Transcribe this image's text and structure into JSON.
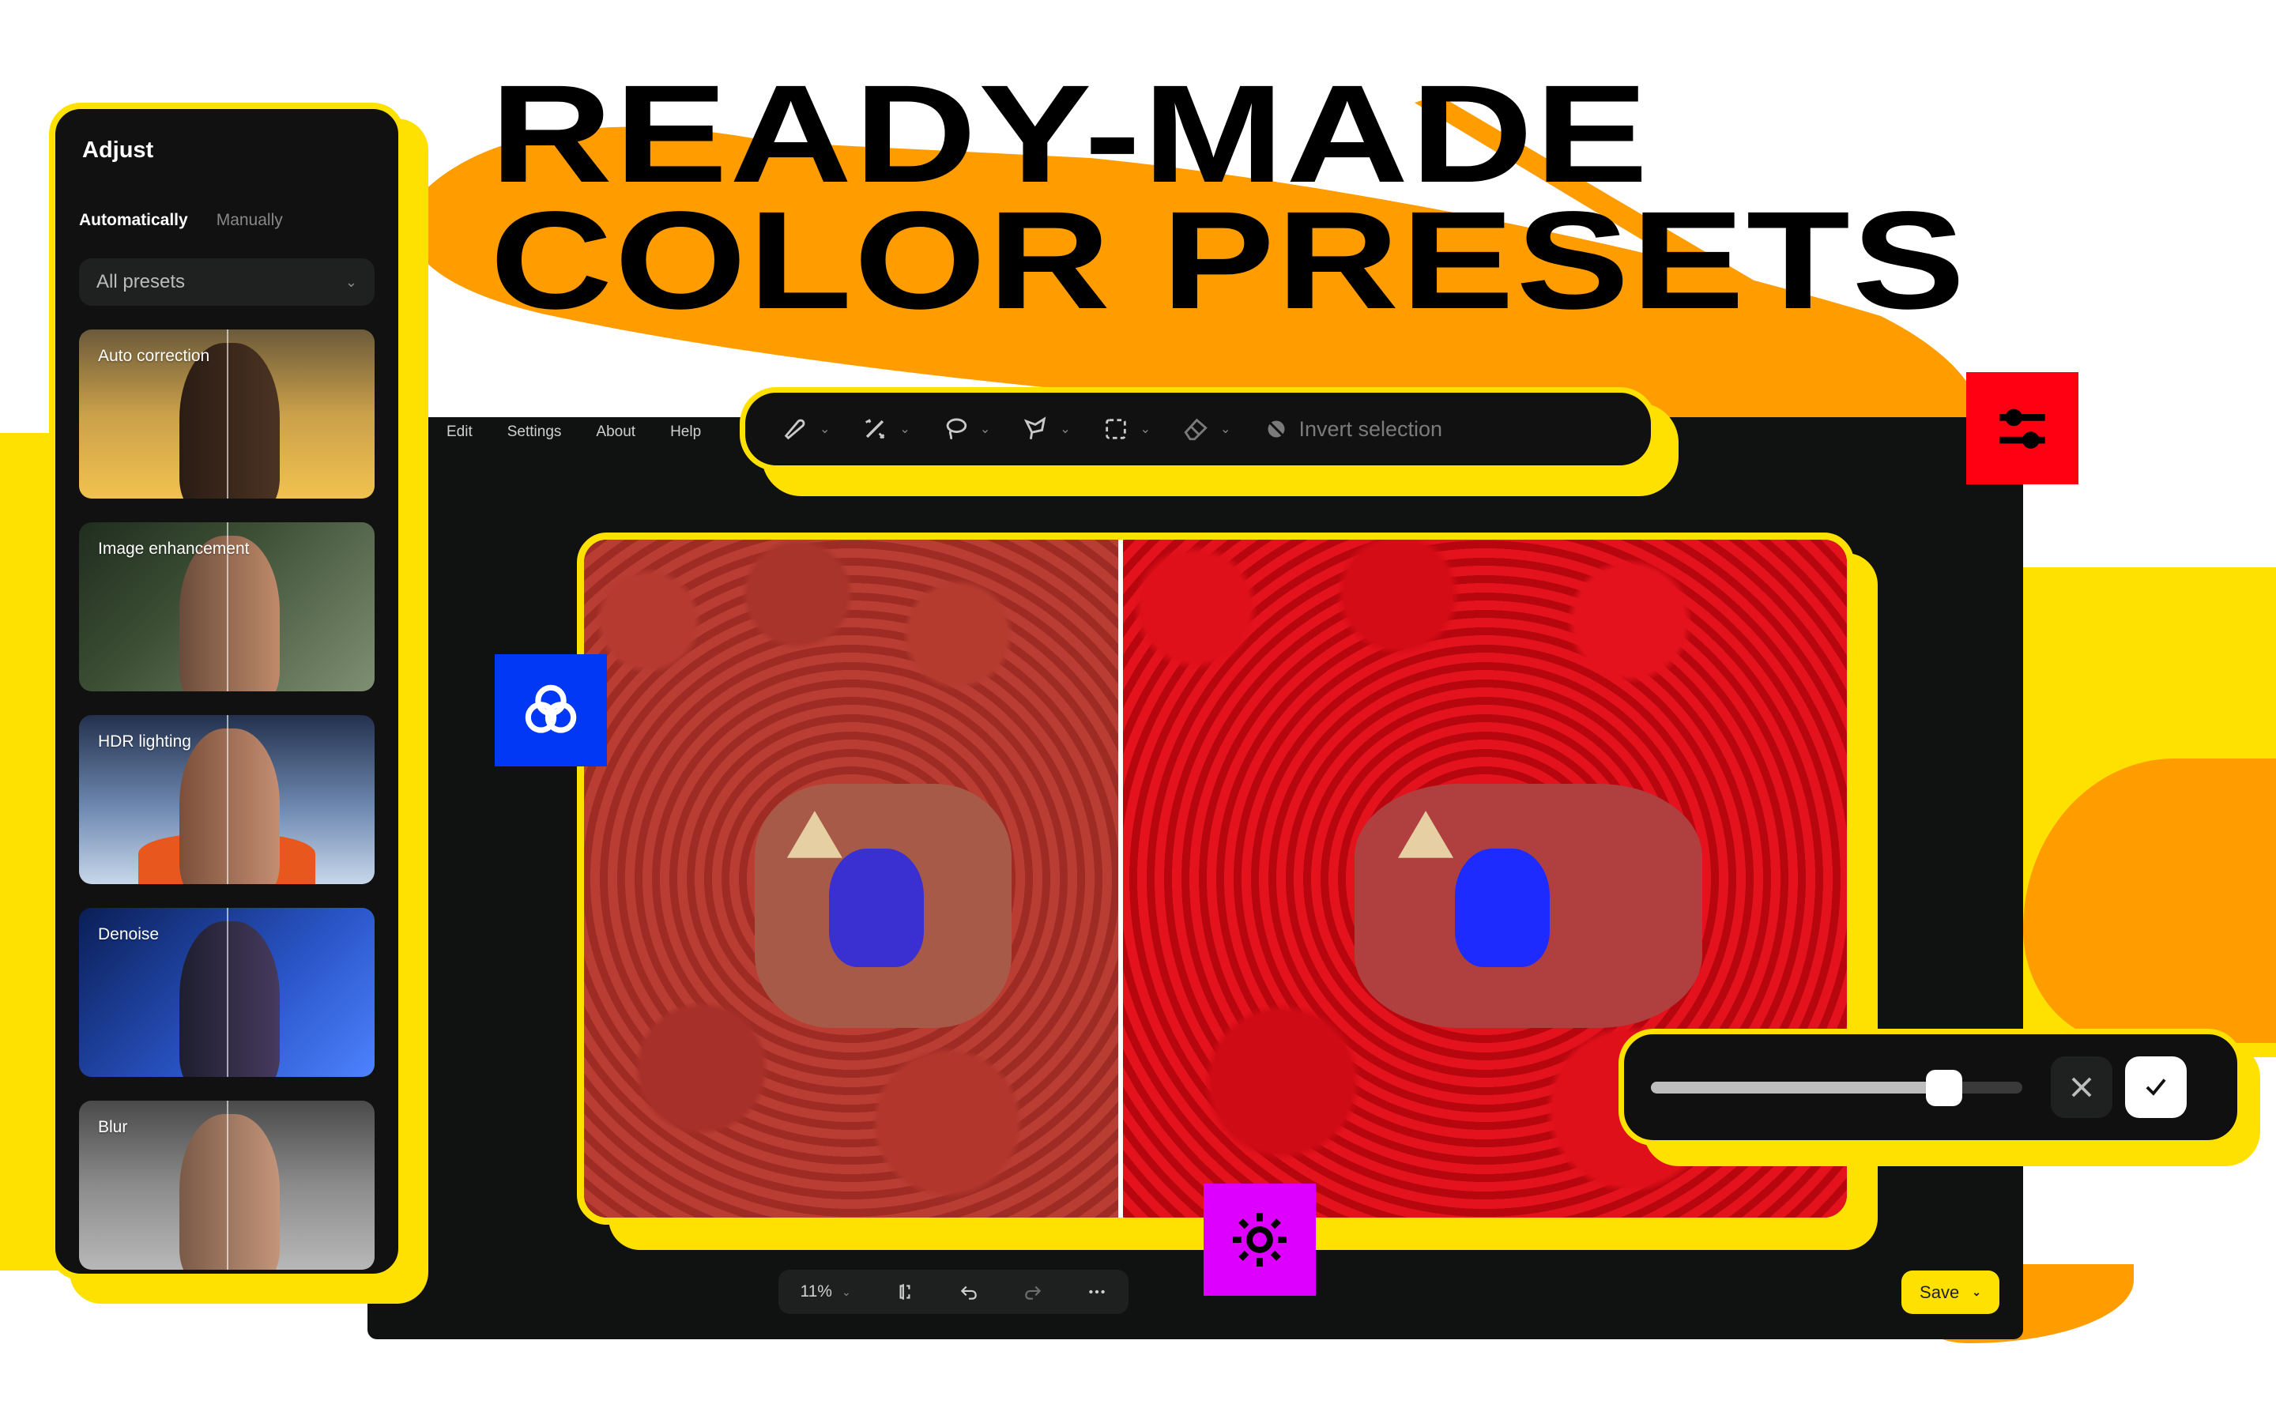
{
  "headline": {
    "line1": "READY-MADE",
    "line2": "COLOR PRESETS"
  },
  "colors": {
    "accent_yellow": "#FFE100",
    "accent_orange": "#FF9C00",
    "badge_blue": "#0038F5",
    "badge_red": "#FF0013",
    "badge_purple": "#DD00FF",
    "panel_bg": "#111111"
  },
  "adjust_panel": {
    "title": "Adjust",
    "tabs": [
      {
        "label": "Automatically",
        "active": true
      },
      {
        "label": "Manually",
        "active": false
      }
    ],
    "preset_select": {
      "value": "All presets"
    },
    "presets": [
      {
        "label": "Auto correction"
      },
      {
        "label": "Image enhancement"
      },
      {
        "label": "HDR lighting"
      },
      {
        "label": "Denoise"
      },
      {
        "label": "Blur"
      }
    ]
  },
  "menu": {
    "items": [
      "Edit",
      "Settings",
      "About",
      "Help"
    ]
  },
  "toolbar": {
    "tools": [
      {
        "icon": "brush-icon"
      },
      {
        "icon": "magic-wand-icon"
      },
      {
        "icon": "lasso-icon"
      },
      {
        "icon": "polygon-lasso-icon"
      },
      {
        "icon": "rect-select-icon"
      },
      {
        "icon": "eraser-icon"
      }
    ],
    "invert_label": "Invert selection"
  },
  "bottom_bar": {
    "zoom": "11%"
  },
  "save_button": {
    "label": "Save"
  },
  "intensity_slider": {
    "value": 0.79
  }
}
